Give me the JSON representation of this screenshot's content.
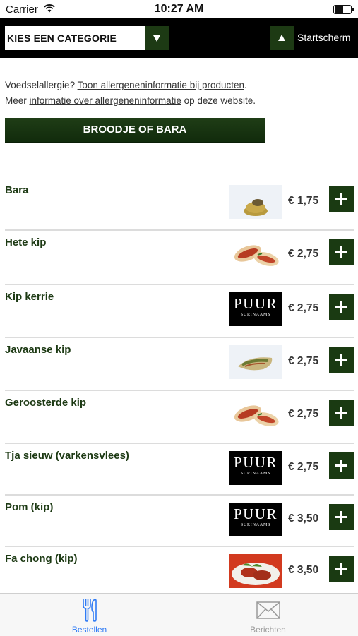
{
  "status_bar": {
    "carrier": "Carrier",
    "time": "10:27 AM",
    "battery_level": 0.55
  },
  "header": {
    "category_select": "KIES EEN CATEGORIE",
    "home_label": "Startscherm"
  },
  "info": {
    "line1_prefix": "Voedselallergie? ",
    "line1_link": "Toon allergeneninformatie bij producten",
    "line1_suffix": ".",
    "line2_prefix": "Meer ",
    "line2_link": "informatie over allergeneninformatie",
    "line2_suffix": " op deze website."
  },
  "section": {
    "title": "BROODJE OF BARA"
  },
  "products": [
    {
      "name": "Bara",
      "price": "€ 1,75",
      "image": "bara-photo"
    },
    {
      "name": "Hete kip",
      "price": "€ 2,75",
      "image": "sandwich-photo"
    },
    {
      "name": "Kip kerrie",
      "price": "€ 2,75",
      "image": "puur-logo"
    },
    {
      "name": "Javaanse kip",
      "price": "€ 2,75",
      "image": "wrap-photo"
    },
    {
      "name": "Geroosterde kip",
      "price": "€ 2,75",
      "image": "sandwich-photo"
    },
    {
      "name": "Tja sieuw (varkensvlees)",
      "price": "€ 2,75",
      "image": "puur-logo"
    },
    {
      "name": "Pom (kip)",
      "price": "€ 3,50",
      "image": "puur-logo"
    },
    {
      "name": "Fa chong (kip)",
      "price": "€ 3,50",
      "image": "meat-photo"
    }
  ],
  "puur_logo": {
    "main": "PUUR",
    "sub": "SURINAAMS"
  },
  "tabs": [
    {
      "label": "Bestellen",
      "icon": "cutlery-icon",
      "active": true,
      "color": "#2f7bf5"
    },
    {
      "label": "Berichten",
      "icon": "envelope-icon",
      "active": false,
      "color": "#9a9a9a"
    }
  ],
  "colors": {
    "brand_green": "#1d3a14",
    "header_black": "#000000",
    "active_tab": "#2f7bf5",
    "inactive_tab": "#9a9a9a"
  }
}
